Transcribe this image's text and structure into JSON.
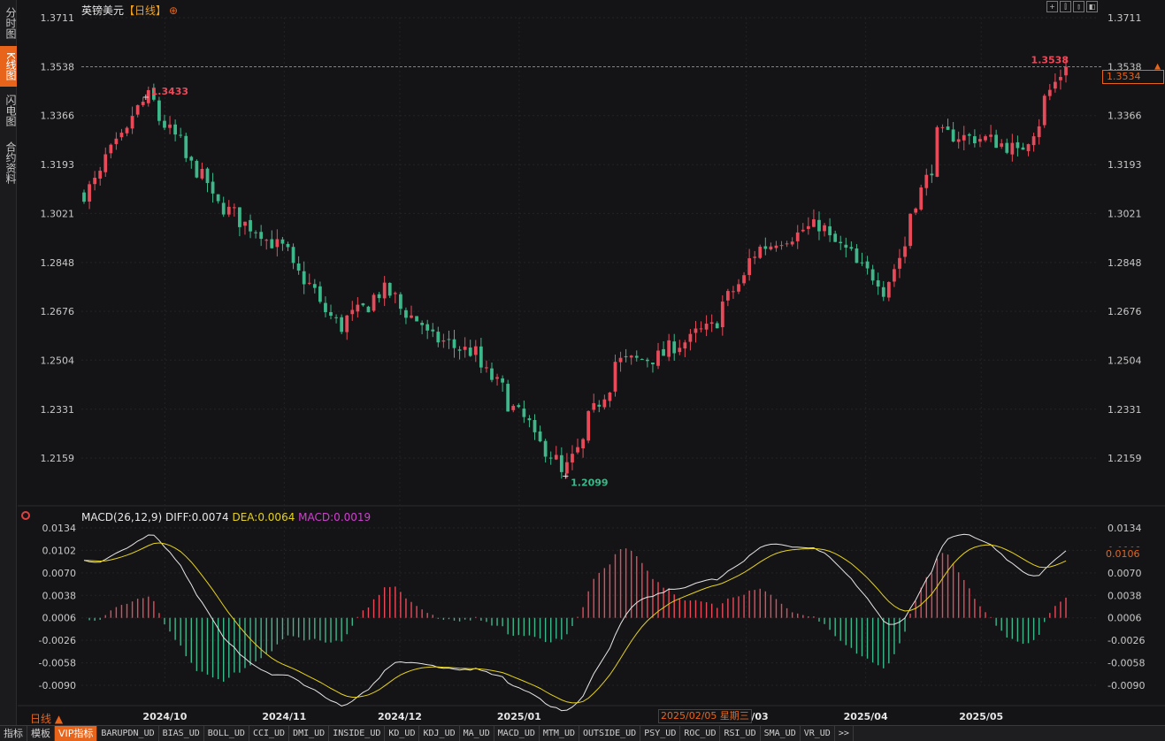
{
  "sidebar": {
    "tabs": [
      {
        "label": "分时图",
        "active": false
      },
      {
        "label": "K线图",
        "active": true
      },
      {
        "label": "闪电图",
        "active": false
      },
      {
        "label": "合约资料",
        "active": false
      }
    ]
  },
  "header": {
    "instrument": "英镑美元",
    "period": "【日线】",
    "add_symbol": "⊕",
    "toolbar_icons": [
      "crosshair-icon",
      "zoom-in-icon",
      "zoom-out-icon",
      "fit-icon"
    ]
  },
  "price_axis": {
    "ticks": [
      "1.3711",
      "1.3538",
      "1.3366",
      "1.3193",
      "1.3021",
      "1.2848",
      "1.2676",
      "1.2504",
      "1.2331",
      "1.2159"
    ],
    "current_price": "1.3534",
    "last_close_line": "1.3538"
  },
  "annotations": {
    "high_left": "1.3433",
    "low": "1.2099",
    "high_right": "1.3538"
  },
  "macd_panel": {
    "title": "MACD(26,12,9)",
    "diff_label": "DIFF:0.0074",
    "dea_label": "DEA:0.0064",
    "macd_label": "MACD:0.0019",
    "ticks": [
      "0.0134",
      "0.0102",
      "0.0070",
      "0.0038",
      "0.0006",
      "-0.0026",
      "-0.0058",
      "-0.0090"
    ],
    "current_value": "0.0106"
  },
  "time_axis": {
    "labels": [
      "2024/10",
      "2024/11",
      "2024/12",
      "2025/01",
      "2025/03",
      "2025/04",
      "2025/05"
    ],
    "cursor_date": "2025/02/05 星期三",
    "period_label": "日线 ▲"
  },
  "bottom_tabs": [
    "指标",
    "模板",
    "VIP指标",
    "BARUPDN_UD",
    "BIAS_UD",
    "BOLL_UD",
    "CCI_UD",
    "DMI_UD",
    "INSIDE_UD",
    "KD_UD",
    "KDJ_UD",
    "MA_UD",
    "MACD_UD",
    "MTM_UD",
    "OUTSIDE_UD",
    "PSY_UD",
    "ROC_UD",
    "RSI_UD",
    "SMA_UD",
    "VR_UD",
    ">>"
  ],
  "colors": {
    "up": "#e84a5a",
    "down": "#3cb88a",
    "diff": "#e6e6e6",
    "dea": "#e6d21e",
    "accent": "#e8641a"
  },
  "chart_data": {
    "type": "candlestick",
    "title": "英镑美元【日线】",
    "y_range": [
      1.2099,
      1.3711
    ],
    "x_range": [
      "2024-09-10",
      "2025-05-23"
    ],
    "grid": true,
    "key_points": [
      {
        "date": "2024-09-10",
        "value": 1.309
      },
      {
        "date": "2024-09-26",
        "value": 1.3433
      },
      {
        "date": "2024-10-15",
        "value": 1.305
      },
      {
        "date": "2024-10-31",
        "value": 1.29
      },
      {
        "date": "2024-11-15",
        "value": 1.262
      },
      {
        "date": "2024-11-27",
        "value": 1.275
      },
      {
        "date": "2024-12-10",
        "value": 1.258
      },
      {
        "date": "2024-12-20",
        "value": 1.253
      },
      {
        "date": "2025-01-13",
        "value": 1.2099
      },
      {
        "date": "2025-01-27",
        "value": 1.25
      },
      {
        "date": "2025-02-05",
        "value": 1.251
      },
      {
        "date": "2025-02-20",
        "value": 1.262
      },
      {
        "date": "2025-03-05",
        "value": 1.29
      },
      {
        "date": "2025-03-20",
        "value": 1.298
      },
      {
        "date": "2025-04-07",
        "value": 1.275
      },
      {
        "date": "2025-04-21",
        "value": 1.33
      },
      {
        "date": "2025-05-05",
        "value": 1.328
      },
      {
        "date": "2025-05-12",
        "value": 1.323
      },
      {
        "date": "2025-05-23",
        "value": 1.3538
      }
    ],
    "macd": {
      "diff_start": 0.0088,
      "diff_end": 0.0074,
      "dea_end": 0.0064,
      "hist_end": 0.0019,
      "y_range": [
        -0.0105,
        0.0134
      ]
    }
  }
}
